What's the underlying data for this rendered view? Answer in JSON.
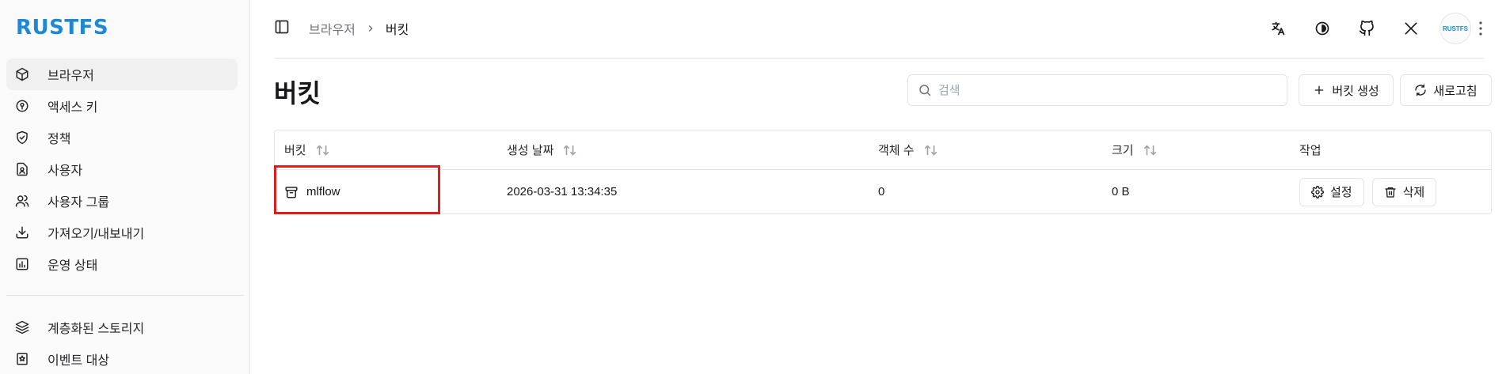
{
  "app": {
    "logo": "RUSTFS",
    "brand_color": "#1e88d0"
  },
  "sidebar": {
    "items": [
      {
        "label": "브라우저",
        "icon": "cube-icon",
        "active": true
      },
      {
        "label": "액세스 키",
        "icon": "key-circle-icon"
      },
      {
        "label": "정책",
        "icon": "shield-check-icon"
      },
      {
        "label": "사용자",
        "icon": "user-file-icon"
      },
      {
        "label": "사용자 그룹",
        "icon": "users-icon"
      },
      {
        "label": "가져오기/내보내기",
        "icon": "download-icon"
      },
      {
        "label": "운영 상태",
        "icon": "chart-icon"
      }
    ],
    "items2": [
      {
        "label": "계층화된 스토리지",
        "icon": "layers-icon"
      },
      {
        "label": "이벤트 대상",
        "icon": "bookmark-star-icon"
      }
    ]
  },
  "header": {
    "breadcrumb": [
      "브라우저",
      "버킷"
    ],
    "icons": [
      "translate-icon",
      "theme-icon",
      "github-icon",
      "x-icon"
    ],
    "avatar_text": "RUSTFS"
  },
  "page": {
    "title": "버킷",
    "search_placeholder": "검색",
    "create_label": "버킷 생성",
    "refresh_label": "새로고침"
  },
  "table": {
    "columns": [
      "버킷",
      "생성 날짜",
      "객체 수",
      "크기",
      "작업"
    ],
    "rows": [
      {
        "name": "mlflow",
        "created": "2026-03-31 13:34:35",
        "objects": "0",
        "size": "0 B"
      }
    ],
    "actions": {
      "settings": "설정",
      "delete": "삭제"
    }
  },
  "highlight_color": "#dc1e1e"
}
